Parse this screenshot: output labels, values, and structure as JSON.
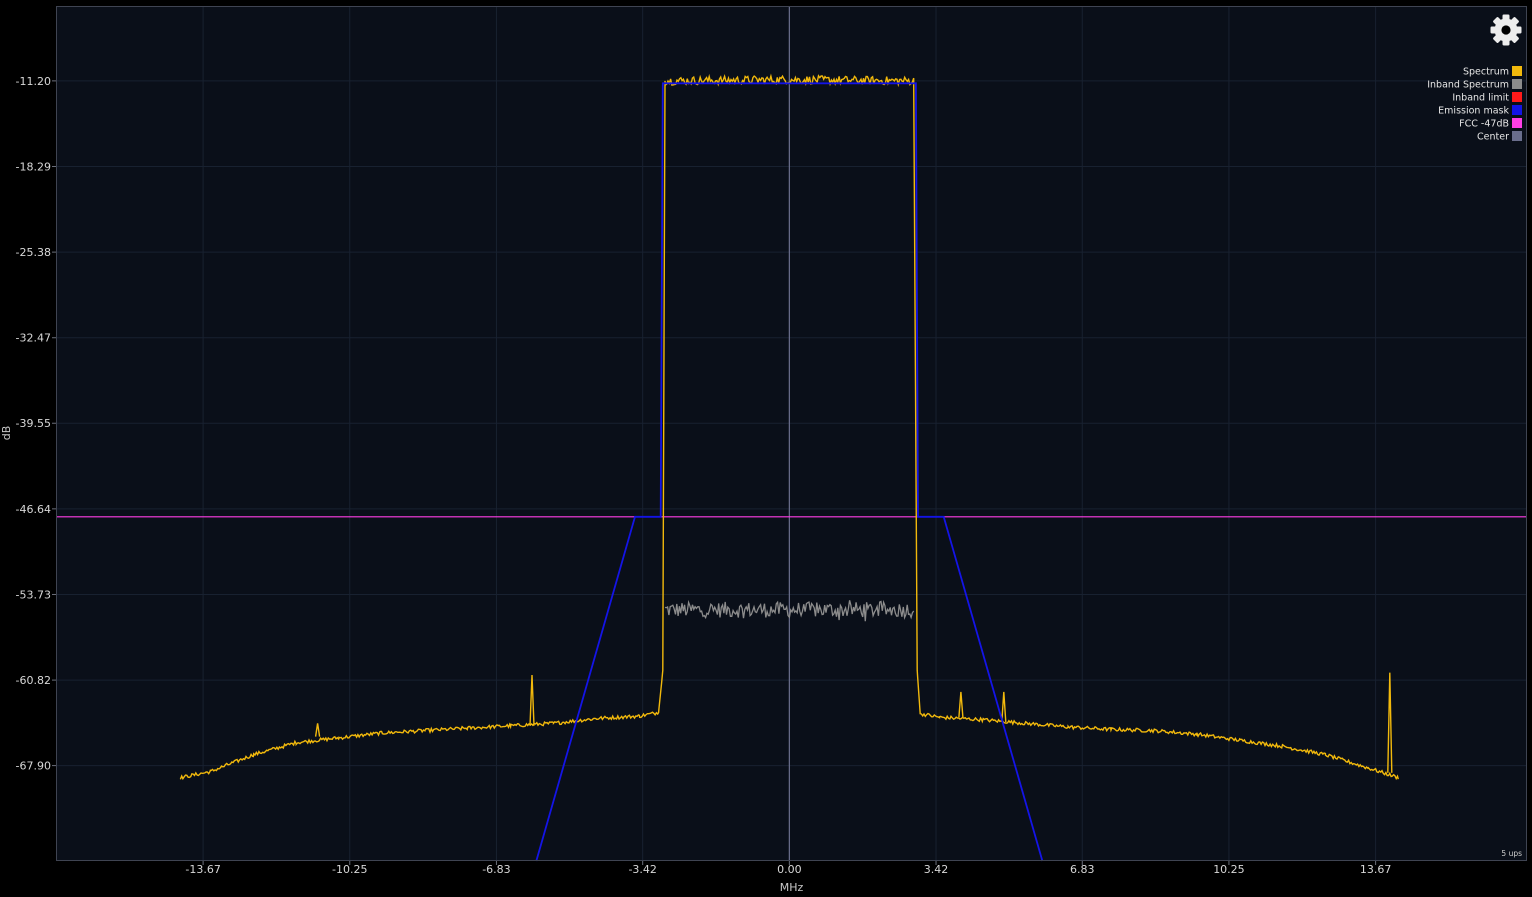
{
  "chart_data": {
    "type": "line",
    "xlabel": "MHz",
    "ylabel": "dB",
    "xlim": [
      -17.1,
      17.2
    ],
    "ylim": [
      -75.8,
      -5.0
    ],
    "x_ticks": [
      "-13.67",
      "-10.25",
      "-6.83",
      "-3.42",
      "0.00",
      "3.42",
      "6.83",
      "10.25",
      "13.67"
    ],
    "y_ticks": [
      "-11.20",
      "-18.29",
      "-25.38",
      "-32.47",
      "-39.55",
      "-46.64",
      "-53.73",
      "-60.82",
      "-67.90"
    ],
    "grid": true,
    "legend_position": "top-right",
    "series": [
      {
        "name": "Spectrum",
        "color": "#f2b90c",
        "points": [
          [
            -14.2,
            -68.9
          ],
          [
            -13.5,
            -68.4
          ],
          [
            -12.5,
            -67.0
          ],
          [
            -11.5,
            -66.0
          ],
          [
            -10.5,
            -65.6
          ],
          [
            -9.5,
            -65.2
          ],
          [
            -8.5,
            -65.0
          ],
          [
            -7.5,
            -64.8
          ],
          [
            -6.5,
            -64.6
          ],
          [
            -5.5,
            -64.4
          ],
          [
            -4.5,
            -64.0
          ],
          [
            -3.5,
            -63.8
          ],
          [
            -3.05,
            -63.5
          ],
          [
            -2.95,
            -60.0
          ],
          [
            -2.9,
            -11.2
          ],
          [
            0.0,
            -11.1
          ],
          [
            2.9,
            -11.2
          ],
          [
            2.98,
            -60.0
          ],
          [
            3.05,
            -63.6
          ],
          [
            3.5,
            -63.9
          ],
          [
            4.5,
            -64.1
          ],
          [
            5.5,
            -64.4
          ],
          [
            6.5,
            -64.7
          ],
          [
            7.5,
            -64.9
          ],
          [
            8.5,
            -65.0
          ],
          [
            9.5,
            -65.3
          ],
          [
            10.5,
            -65.8
          ],
          [
            11.5,
            -66.3
          ],
          [
            12.5,
            -67.0
          ],
          [
            13.5,
            -68.1
          ],
          [
            14.2,
            -68.9
          ]
        ],
        "spurs": [
          [
            -11.0,
            -65.5,
            -64.4
          ],
          [
            -6.0,
            -64.6,
            -60.4
          ],
          [
            4.0,
            -63.9,
            -61.8
          ],
          [
            5.0,
            -64.3,
            -61.8
          ],
          [
            14.0,
            -68.5,
            -60.2
          ]
        ]
      },
      {
        "name": "Inband Spectrum",
        "color": "#8c8c8c",
        "x_range": [
          -2.9,
          2.9
        ],
        "level": -55.0
      },
      {
        "name": "Inband limit",
        "color": "#ff1a1a"
      },
      {
        "name": "Emission mask",
        "color": "#1414e6",
        "points": [
          [
            -5.9,
            -75.8
          ],
          [
            -3.6,
            -47.3
          ],
          [
            -3.0,
            -47.3
          ],
          [
            -2.95,
            -11.4
          ],
          [
            2.95,
            -11.4
          ],
          [
            3.0,
            -47.3
          ],
          [
            3.6,
            -47.3
          ],
          [
            5.9,
            -75.8
          ]
        ]
      },
      {
        "name": "FCC -47dB",
        "color": "#ff3fe6",
        "y": -47.3
      },
      {
        "name": "Center",
        "color": "#6a6e8c",
        "x": 0.0
      }
    ]
  },
  "status": {
    "fps": "5 ups"
  },
  "settings": {
    "icon": "gear-icon"
  }
}
